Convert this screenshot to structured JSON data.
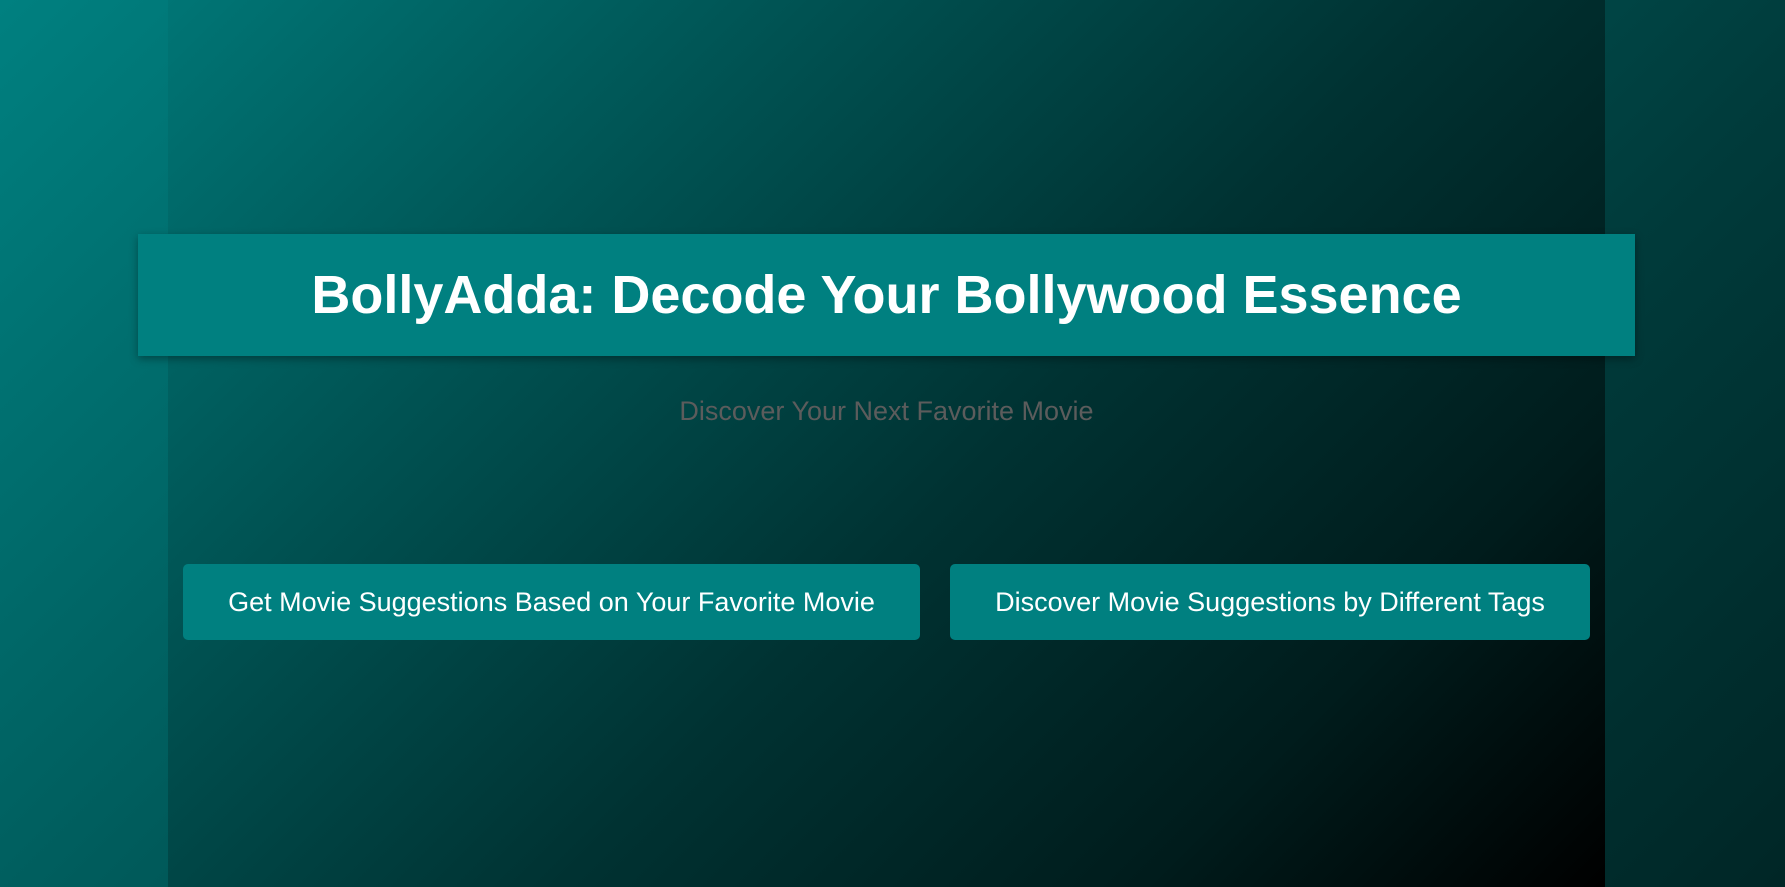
{
  "header": {
    "title": "BollyAdda: Decode Your Bollywood Essence"
  },
  "hero": {
    "subtitle": "Discover Your Next Favorite Movie"
  },
  "actions": {
    "favorite_movie_label": "Get Movie Suggestions Based on Your Favorite Movie",
    "tags_label": "Discover Movie Suggestions by Different Tags"
  },
  "colors": {
    "accent": "#008080",
    "title_text": "#ffffff",
    "subtitle_text": "#5c5c5c"
  }
}
